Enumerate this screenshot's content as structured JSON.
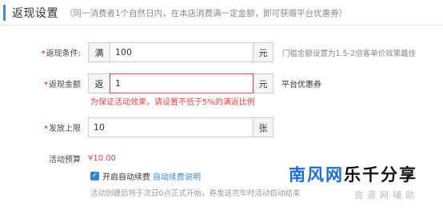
{
  "header": {
    "title": "返现设置",
    "description": "（同一消费者1个自然日内，在本店消费满一定金额，即可获赠平台优惠券）"
  },
  "form": {
    "required_mark": "*",
    "condition": {
      "label": "返现条件:",
      "prefix": "满",
      "value": "100",
      "suffix": "元",
      "hint": "门槛金额设置为1.5-2倍客单价效果最佳"
    },
    "amount": {
      "label": "返现金额",
      "prefix": "返",
      "value": "1",
      "suffix": "元",
      "after": "平台优惠券",
      "error": "为保证活动效果，请设置不低于5%的满返比例"
    },
    "limit": {
      "label": "发放上限",
      "value": "10",
      "suffix": "张"
    },
    "budget": {
      "label": "活动预算",
      "value": "¥10.00"
    },
    "auto_renew": {
      "checked": true,
      "label": "开启自动续费",
      "link": "自动续费说明",
      "note": "活动创建后将于次日0点正式开始，券发送完毕时活动自动结束"
    }
  },
  "watermark": {
    "part1": "南风网",
    "part2": "乐千分享",
    "sub": "资源网辅助"
  },
  "colors": {
    "accent": "#2f87d6",
    "error": "#e64340",
    "header_bar": "#3a8ee6"
  }
}
